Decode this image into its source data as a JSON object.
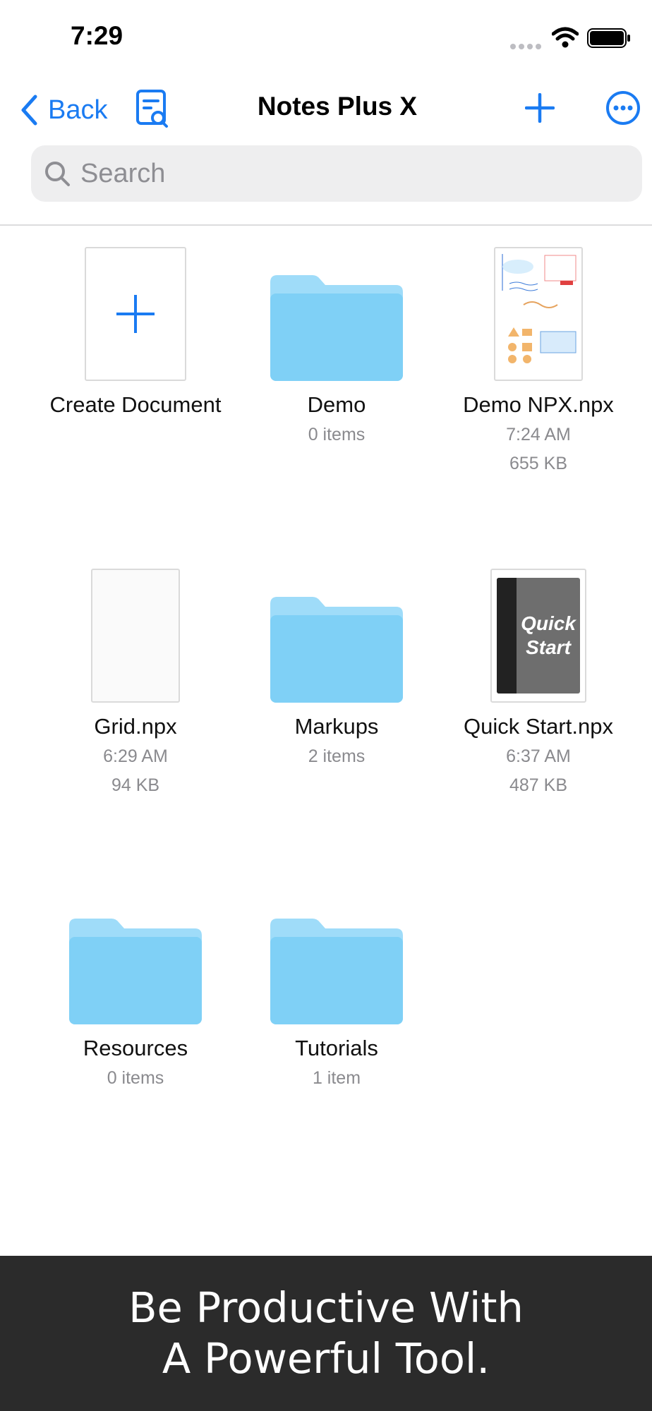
{
  "status_bar": {
    "time": "7:29"
  },
  "nav": {
    "back_label": "Back",
    "title": "Notes Plus X"
  },
  "search": {
    "placeholder": "Search"
  },
  "items": [
    {
      "name": "Create Document",
      "type": "create"
    },
    {
      "name": "Demo",
      "type": "folder",
      "meta1": "0 items"
    },
    {
      "name": "Demo NPX.npx",
      "type": "document",
      "meta1": "7:24 AM",
      "meta2": "655 KB"
    },
    {
      "name": "Grid.npx",
      "type": "document",
      "meta1": "6:29 AM",
      "meta2": "94 KB"
    },
    {
      "name": "Markups",
      "type": "folder",
      "meta1": "2 items"
    },
    {
      "name": "Quick Start.npx",
      "type": "document",
      "meta1": "6:37 AM",
      "meta2": "487 KB",
      "cover_text": "Quick Start"
    },
    {
      "name": "Resources",
      "type": "folder",
      "meta1": "0 items"
    },
    {
      "name": "Tutorials",
      "type": "folder",
      "meta1": "1 item"
    }
  ],
  "banner": {
    "line1": "Be Productive With",
    "line2": "A Powerful Tool."
  },
  "colors": {
    "accent": "#1A7BF2",
    "folder": "#7FD0F6",
    "banner_bg": "#2B2B2B"
  }
}
